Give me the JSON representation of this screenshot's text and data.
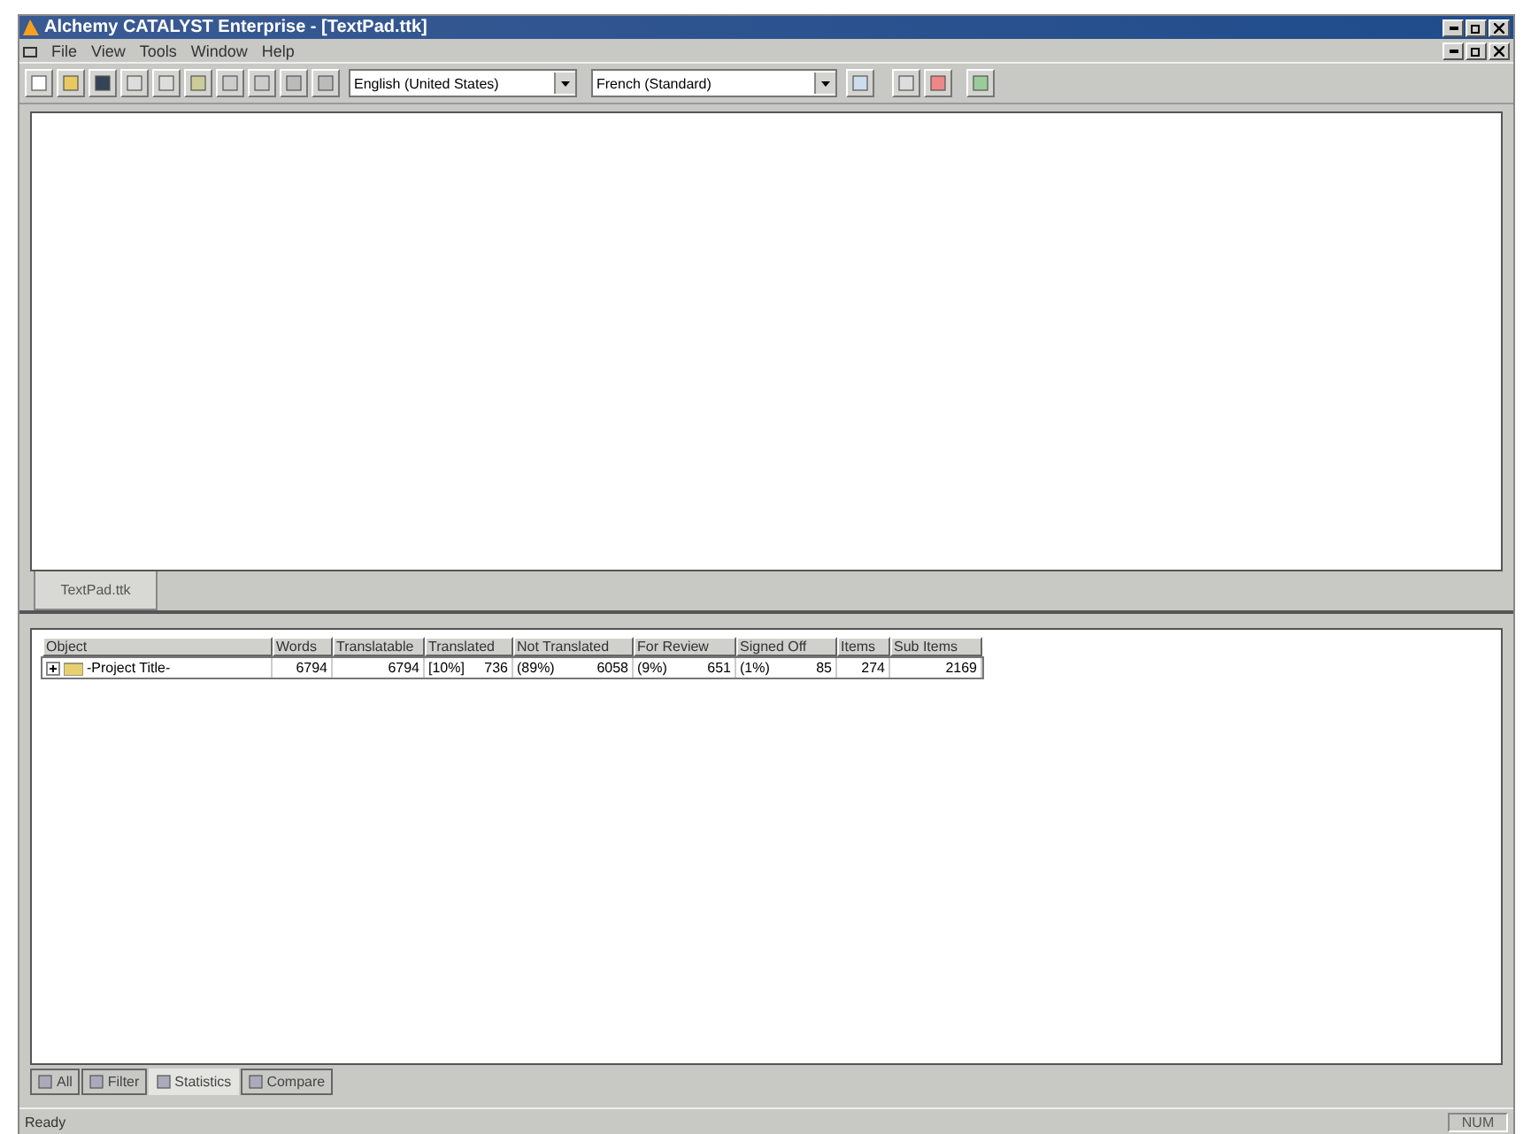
{
  "window": {
    "title": "Alchemy CATALYST Enterprise - [TextPad.ttk]"
  },
  "menu": [
    "File",
    "View",
    "Tools",
    "Window",
    "Help"
  ],
  "toolbar": {
    "source_language": "English (United States)",
    "target_language": "French (Standard)"
  },
  "document_tabs": [
    {
      "label": "TextPad.ttk",
      "selected": true
    }
  ],
  "table": {
    "columns": [
      "Object",
      "Words",
      "Translatable",
      "Translated",
      "Not Translated",
      "For Review",
      "Signed Off",
      "Items",
      "Sub Items"
    ],
    "rows": [
      {
        "expanded": false,
        "cells": [
          {
            "value": "-Project Title-"
          },
          {
            "value": "6794"
          },
          {
            "value": "6794"
          },
          {
            "pct": "[10%]",
            "value": "736"
          },
          {
            "pct": "(89%)",
            "value": "6058"
          },
          {
            "pct": "(9%)",
            "value": "651"
          },
          {
            "pct": "(1%)",
            "value": "85"
          },
          {
            "value": "274"
          },
          {
            "value": "2169"
          }
        ]
      }
    ]
  },
  "view_tabs": [
    {
      "label": "All",
      "selected": false
    },
    {
      "label": "Filter",
      "selected": false
    },
    {
      "label": "Statistics",
      "selected": true
    },
    {
      "label": "Compare",
      "selected": false
    }
  ],
  "status_bar": {
    "message": "Ready",
    "indicator": "NUM"
  }
}
